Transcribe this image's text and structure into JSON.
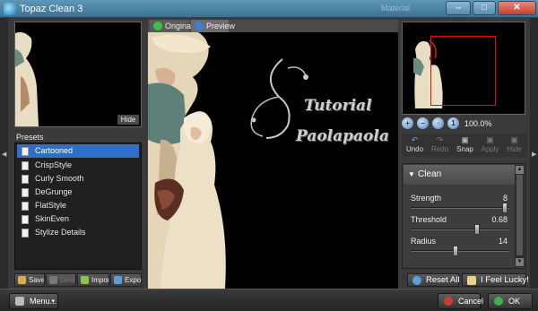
{
  "window": {
    "title": "Topaz Clean 3",
    "ghost_title": "Material",
    "buttons": {
      "restore": "⇔",
      "maximize": "□",
      "close": "✕"
    }
  },
  "left": {
    "hide_label": "Hide",
    "presets_label": "Presets",
    "presets": [
      "Cartooned",
      "CrispStyle",
      "Curly Smooth",
      "DeGrunge",
      "FlatStyle",
      "SkinEven",
      "Stylize Details"
    ],
    "selected_index": 0,
    "buttons": {
      "save": "Save",
      "delete": "Delete",
      "import": "Import",
      "export": "Export"
    }
  },
  "canvas": {
    "tabs": {
      "original": "Original",
      "preview": "Preview"
    },
    "watermark": {
      "line1": "Tutorial",
      "line2": "Paolapaola"
    }
  },
  "right": {
    "zoom_value": "100.0%",
    "actions": [
      "Undo",
      "Redo",
      "Snap",
      "Apply",
      "Hide"
    ],
    "panel_title": "Clean",
    "params": [
      {
        "label": "Strength",
        "value": "8",
        "level": 0.98
      },
      {
        "label": "Threshold",
        "value": "0.68",
        "level": 0.68
      },
      {
        "label": "Radius",
        "value": "14",
        "level": 0.45
      }
    ],
    "reset_label": "Reset All",
    "lucky_label": "I Feel Lucky!"
  },
  "status": {
    "menu_label": "Menu...",
    "cancel_label": "Cancel",
    "ok_label": "OK"
  },
  "colors": {
    "accent": "#2e6fc7",
    "selection_rect": "#e01010",
    "titlebar": "#4f86a8"
  },
  "icons": {
    "preset": "document-icon",
    "zoom": [
      "zoom-in-icon",
      "zoom-out-icon",
      "fit-icon",
      "actual-size-icon"
    ],
    "actions": [
      "undo-icon",
      "redo-icon",
      "camera-icon",
      "apply-icon",
      "hide-icon"
    ]
  }
}
